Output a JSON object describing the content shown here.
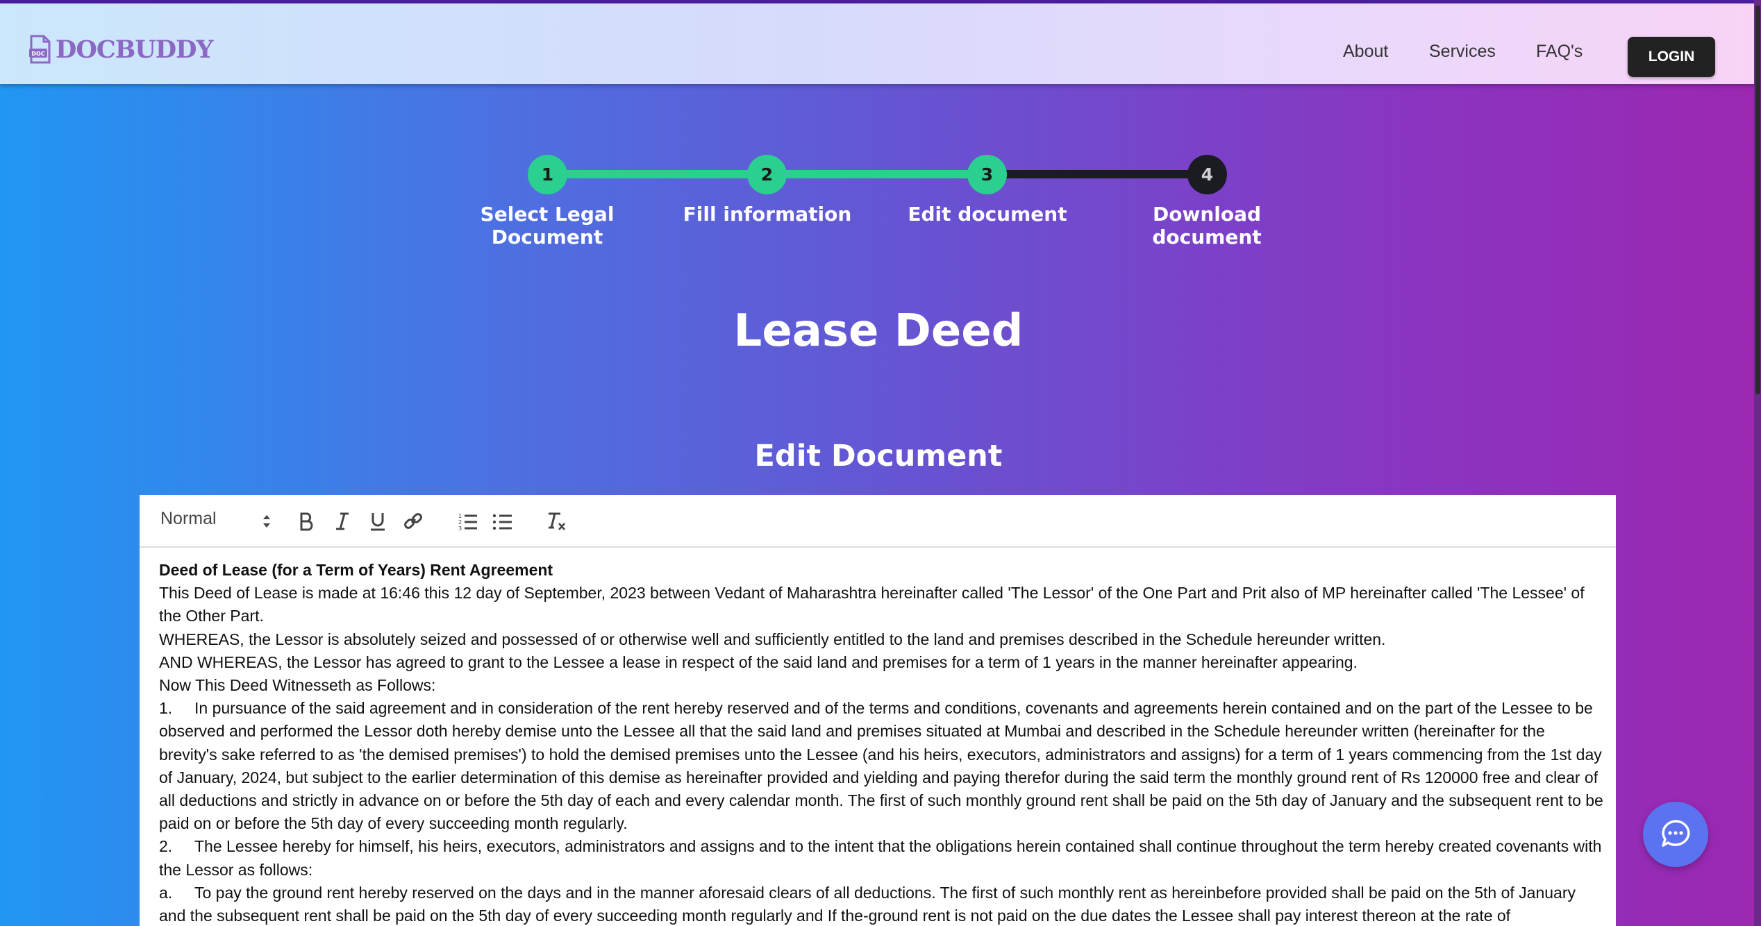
{
  "brand": {
    "name": "DOCBUDDY",
    "icon_text": "DOC"
  },
  "nav": {
    "links": [
      "About",
      "Services",
      "FAQ's"
    ],
    "login_label": "LOGIN"
  },
  "stepper": {
    "current_step": 3,
    "steps": [
      {
        "number": "1",
        "label": "Select Legal Document",
        "status": "done"
      },
      {
        "number": "2",
        "label": "Fill information",
        "status": "done"
      },
      {
        "number": "3",
        "label": "Edit document",
        "status": "done"
      },
      {
        "number": "4",
        "label": "Download document",
        "status": "todo"
      }
    ]
  },
  "page_title": "Lease Deed",
  "section_title": "Edit Document",
  "editor": {
    "toolbar": {
      "format_value": "Normal",
      "buttons": [
        "bold-icon",
        "italic-icon",
        "underline-icon",
        "link-icon",
        "ordered-list-icon",
        "bullet-list-icon",
        "clear-format-icon"
      ]
    },
    "document": {
      "heading": "Deed of Lease (for a Term of Years) Rent Agreement",
      "para1": "This Deed of Lease is made at 16:46 this 12 day of September, 2023 between Vedant of Maharashtra hereinafter called 'The Lessor' of the One Part and Prit also of MP hereinafter called 'The Lessee' of the Other Part.",
      "para2": "WHEREAS, the Lessor is absolutely seized and possessed of or otherwise well and sufficiently entitled to the land and premises described in the Schedule hereunder written.",
      "para3": "AND WHEREAS, the Lessor has agreed to grant to the Lessee a lease in respect of the said land and premises for a term of 1 years in the manner hereinafter appearing.",
      "para4": "Now This Deed Witnesseth as Follows:",
      "item1_num": "1.",
      "item1": "In pursuance of the said agreement and in consideration of the rent hereby reserved and of the terms and conditions, covenants and agreements herein contained and on the part of the Lessee to be observed and performed the Lessor doth hereby demise unto the Lessee all that the said land and premises situated at Mumbai and described in the Schedule hereunder written (hereinafter for the brevity's sake referred to as 'the demised premises') to hold the demised premises unto the Lessee (and his heirs, executors, administrators and assigns) for a term of 1 years commencing from the 1st day of January, 2024, but subject to the earlier determination of this demise as hereinafter provided and yielding and paying therefor during the said term the monthly ground rent of Rs 120000 free and clear of all deductions and strictly in advance on or before the 5th day of each and every calendar month. The first of such monthly ground rent shall be paid on the 5th day of January and the subsequent rent to be paid on or before the 5th day of every succeeding month regularly.",
      "item2_num": "2.",
      "item2": "The Lessee hereby for himself, his heirs, executors, administrators and assigns and to the intent that the obligations herein contained shall continue throughout the term hereby created covenants with the Lessor as follows:",
      "itemA_num": "a.",
      "itemA": "To pay the ground rent hereby reserved on the days and in the manner aforesaid clears of all deductions. The first of such monthly rent as hereinbefore provided shall be paid on the 5th of January and the subsequent rent shall be paid on the 5th day of every succeeding month regularly and If the-ground rent is not paid on the due dates the Lessee shall pay interest thereon at the rate of"
    }
  },
  "colors": {
    "step_done": "#2bcf8f",
    "step_todo": "#1b1b22",
    "brand": "#8a68c4",
    "chat_button": "#5b73f0"
  }
}
